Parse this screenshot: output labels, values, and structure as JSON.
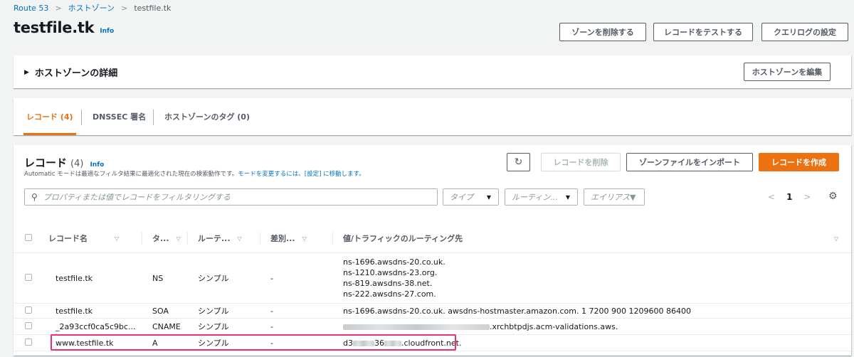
{
  "breadcrumb": {
    "items": [
      "Route 53",
      "ホストゾーン"
    ],
    "current": "testfile.tk"
  },
  "header": {
    "title": "testfile.tk",
    "info": "Info",
    "buttons": {
      "delete_zone": "ゾーンを削除する",
      "test_record": "レコードをテストする",
      "query_log": "クエリログの設定"
    }
  },
  "details": {
    "title": "ホストゾーンの詳細",
    "edit_button": "ホストゾーンを編集"
  },
  "tabs": [
    {
      "label": "レコード (4)"
    },
    {
      "label": "DNSSEC 署名"
    },
    {
      "label": "ホストゾーンのタグ (0)"
    }
  ],
  "records_panel": {
    "title": "レコード",
    "count": "(4)",
    "info": "Info",
    "description_prefix": "Automatic モードは最適なフィルタ結果に最適化された現在の検索動作です。",
    "description_link": "モードを変更するには、[設定] に移動します。",
    "buttons": {
      "delete": "レコードを削除",
      "import": "ゾーンファイルをインポート",
      "create": "レコードを作成"
    },
    "search_placeholder": "プロパティまたは値でレコードをフィルタリングする",
    "filters": {
      "type": "タイプ",
      "routing": "ルーティン...",
      "alias": "エイリアス▼"
    },
    "pagination": {
      "prev": "<",
      "page": "1",
      "next": ">"
    },
    "columns": [
      "レコード名",
      "タ...",
      "ルーテ...",
      "差別...",
      "値/トラフィックのルーティング先"
    ],
    "rows": [
      {
        "name": "testfile.tk",
        "type": "NS",
        "routing": "シンプル",
        "diff": "-",
        "values": [
          "ns-1696.awsdns-20.co.uk.",
          "ns-1210.awsdns-23.org.",
          "ns-819.awsdns-38.net.",
          "ns-222.awsdns-27.com."
        ]
      },
      {
        "name": "testfile.tk",
        "type": "SOA",
        "routing": "シンプル",
        "diff": "-",
        "values": [
          "ns-1696.awsdns-20.co.uk. awsdns-hostmaster.amazon.com. 1 7200 900 1209600 86400"
        ]
      },
      {
        "name": "_2a93ccf0ca5c9bc...",
        "type": "CNAME",
        "routing": "シンプル",
        "diff": "-",
        "value_suffix": ".xrchbtpdjs.acm-validations.aws."
      },
      {
        "name": "www.testfile.tk",
        "type": "A",
        "routing": "シンプル",
        "diff": "-",
        "value_parts": [
          "d3",
          "36",
          ".cloudfront.net."
        ]
      }
    ]
  },
  "colors": {
    "accent": "#ec7211",
    "link": "#0073bb",
    "highlight": "#e8336e"
  },
  "icons": [
    "chevron-right-icon",
    "caret-right-icon",
    "search-icon",
    "refresh-icon",
    "settings-icon",
    "sort-icon",
    "caret-down-icon"
  ]
}
